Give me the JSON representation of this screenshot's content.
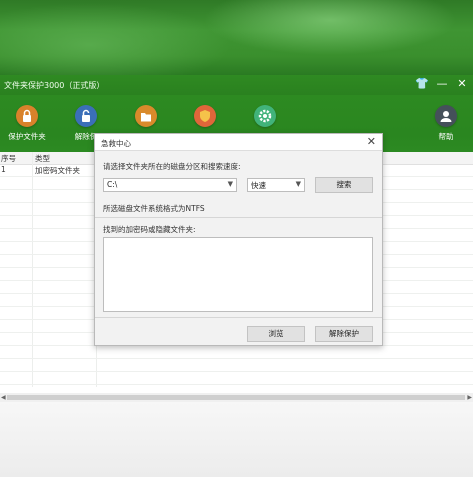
{
  "app": {
    "title": "文件夹保护3000（正式版）",
    "window_controls": {
      "skin": "👕",
      "minimize": "—",
      "close": "✕"
    }
  },
  "toolbar": {
    "items": [
      {
        "label": "保护文件夹",
        "icon": "lock-icon",
        "color": "#d9822b"
      },
      {
        "label": "解除保",
        "icon": "unlock-icon",
        "color": "#3b6fb8"
      },
      {
        "label": "",
        "icon": "folder-icon",
        "color": "#d98a2b"
      },
      {
        "label": "",
        "icon": "shield-icon",
        "color": "#e0663a"
      },
      {
        "label": "",
        "icon": "gear-icon",
        "color": "#41b37a"
      },
      {
        "label": "帮助",
        "icon": "help-icon",
        "color": "#45505a"
      }
    ]
  },
  "table": {
    "columns": [
      "序号",
      "类型"
    ],
    "rows": [
      [
        "1",
        "加密码文件夹"
      ]
    ]
  },
  "dialog": {
    "title": "急救中心",
    "close_label": "✕",
    "prompt": "请选择文件夹所在的磁盘分区和搜索速度:",
    "drive_value": "C:\\",
    "speed_value": "快速",
    "search_button": "搜索",
    "fs_info": "所选磁盘文件系统格式为NTFS",
    "found_label": "找到的加密码或隐藏文件夹:",
    "found_text": "",
    "browse_button": "浏览",
    "unprotect_button": "解除保护"
  }
}
